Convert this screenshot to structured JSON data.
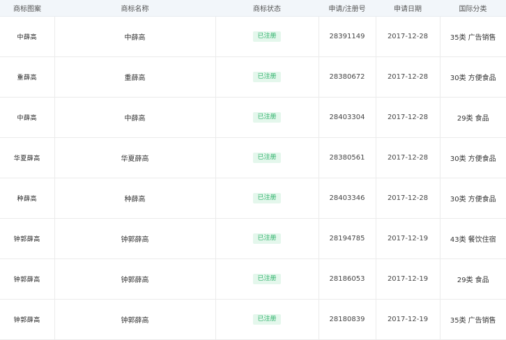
{
  "headers": {
    "image": "商标图案",
    "name": "商标名称",
    "status": "商标状态",
    "app_no": "申请/注册号",
    "date": "申请日期",
    "class": "国际分类"
  },
  "rows": [
    {
      "logo": "中薛高",
      "name": "中薛高",
      "status": "已注册",
      "app_no": "28391149",
      "date": "2017-12-28",
      "class_no": "35类",
      "class_desc": "广告销售"
    },
    {
      "logo": "重薛高",
      "name": "重薛高",
      "status": "已注册",
      "app_no": "28380672",
      "date": "2017-12-28",
      "class_no": "30类",
      "class_desc": "方便食品"
    },
    {
      "logo": "中薛高",
      "name": "中薛高",
      "status": "已注册",
      "app_no": "28403304",
      "date": "2017-12-28",
      "class_no": "29类",
      "class_desc": "食品"
    },
    {
      "logo": "华夏薛高",
      "name": "华夏薛高",
      "status": "已注册",
      "app_no": "28380561",
      "date": "2017-12-28",
      "class_no": "30类",
      "class_desc": "方便食品"
    },
    {
      "logo": "种薛高",
      "name": "种薛高",
      "status": "已注册",
      "app_no": "28403346",
      "date": "2017-12-28",
      "class_no": "30类",
      "class_desc": "方便食品"
    },
    {
      "logo": "钟郭薛高",
      "name": "钟郭薛高",
      "status": "已注册",
      "app_no": "28194785",
      "date": "2017-12-19",
      "class_no": "43类",
      "class_desc": "餐饮住宿"
    },
    {
      "logo": "钟郭薛高",
      "name": "钟郭薛高",
      "status": "已注册",
      "app_no": "28186053",
      "date": "2017-12-19",
      "class_no": "29类",
      "class_desc": "食品"
    },
    {
      "logo": "钟郭薛高",
      "name": "钟郭薛高",
      "status": "已注册",
      "app_no": "28180839",
      "date": "2017-12-19",
      "class_no": "35类",
      "class_desc": "广告销售"
    }
  ],
  "colors": {
    "status_text": "#2fb26b",
    "status_bg": "#e4f7ec",
    "header_bg": "#f2f6fa"
  }
}
